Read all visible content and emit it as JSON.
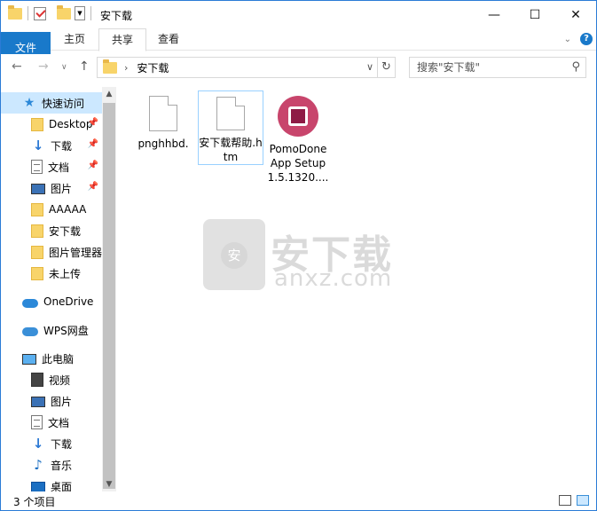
{
  "window": {
    "title": "安下载",
    "controls": {
      "minimize": "—",
      "maximize": "☐",
      "close": "✕"
    }
  },
  "ribbon": {
    "tabs": [
      {
        "label": "文件"
      },
      {
        "label": "主页"
      },
      {
        "label": "共享"
      },
      {
        "label": "查看"
      }
    ],
    "active_tab": "共享",
    "help_label": "?"
  },
  "address_bar": {
    "breadcrumb": [
      "安下载"
    ],
    "search_placeholder": "搜索\"安下载\""
  },
  "nav_pane": {
    "quick_access": {
      "label": "快速访问",
      "items": [
        {
          "label": "Desktop",
          "icon": "folder-icon",
          "pinned": true
        },
        {
          "label": "下载",
          "icon": "download-icon",
          "pinned": true
        },
        {
          "label": "文档",
          "icon": "document-icon",
          "pinned": true
        },
        {
          "label": "图片",
          "icon": "pictures-icon",
          "pinned": true
        },
        {
          "label": "AAAAA",
          "icon": "folder-icon",
          "pinned": false
        },
        {
          "label": "安下载",
          "icon": "folder-icon",
          "pinned": false
        },
        {
          "label": "图片管理器",
          "icon": "folder-icon",
          "pinned": false
        },
        {
          "label": "未上传",
          "icon": "folder-icon",
          "pinned": false
        }
      ]
    },
    "onedrive": {
      "label": "OneDrive"
    },
    "wps": {
      "label": "WPS网盘"
    },
    "this_pc": {
      "label": "此电脑",
      "items": [
        {
          "label": "视频",
          "icon": "video-icon"
        },
        {
          "label": "图片",
          "icon": "pictures-icon"
        },
        {
          "label": "文档",
          "icon": "document-icon"
        },
        {
          "label": "下载",
          "icon": "download-icon"
        },
        {
          "label": "音乐",
          "icon": "music-icon"
        },
        {
          "label": "桌面",
          "icon": "desktop-icon"
        }
      ]
    }
  },
  "files": [
    {
      "name": "pnghhbd.",
      "icon": "blank-file-icon"
    },
    {
      "name": "安下载帮助.htm",
      "icon": "blank-file-icon"
    },
    {
      "name": "PomoDoneApp Setup 1.5.1320....",
      "icon": "pomodone-app-icon"
    }
  ],
  "watermark": {
    "brand": "安下载",
    "domain": "anxz.com",
    "badge": "安"
  },
  "status_bar": {
    "item_count": "3 个项目"
  },
  "colors": {
    "accent": "#1979ca",
    "selection": "#cce8ff"
  }
}
